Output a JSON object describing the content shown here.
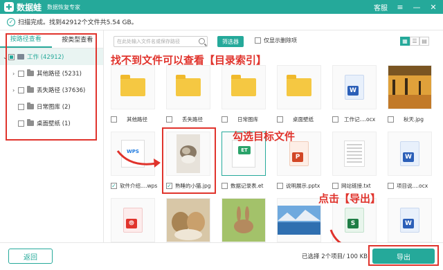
{
  "app": {
    "name": "数据蛙",
    "subtitle": "数据恢复专家",
    "logo_mark": "✚"
  },
  "titlebar": {
    "service": "客服",
    "menu_icon": "≡",
    "minimize": "—",
    "close": "✕"
  },
  "status": {
    "text": "扫描完成。找到42912个文件共5.54 GB。"
  },
  "sidebar": {
    "tabs": [
      {
        "label": "按路径查看",
        "active": true
      },
      {
        "label": "按类型查看",
        "active": false
      }
    ],
    "root": {
      "label": "工作 (42912)"
    },
    "items": [
      {
        "label": "其他路径 (5231)",
        "expandable": true
      },
      {
        "label": "丢失路径 (37636)",
        "expandable": true
      },
      {
        "label": "日常图库 (2)",
        "expandable": false
      },
      {
        "label": "桌面壁纸 (1)",
        "expandable": false
      }
    ]
  },
  "toolbar": {
    "search_placeholder": "在此处输入文件名或保存路径",
    "filter_label": "筛选器",
    "only_deleted_label": "仅显示删除项"
  },
  "tiles": [
    {
      "label": "其他路径",
      "kind": "folder",
      "checked": false
    },
    {
      "label": "丢失路径",
      "kind": "folder",
      "checked": false
    },
    {
      "label": "日常图库",
      "kind": "folder",
      "checked": false
    },
    {
      "label": "桌面壁纸",
      "kind": "folder",
      "checked": false
    },
    {
      "label": "工作记....ocx",
      "kind": "word",
      "checked": false
    },
    {
      "label": "秋天.jpg",
      "kind": "autumn",
      "checked": false
    },
    {
      "label": "软件介绍....wps",
      "kind": "wps",
      "checked": true
    },
    {
      "label": "熟睡的小猫.jpg",
      "kind": "cat",
      "checked": true
    },
    {
      "label": "数据记录表.et",
      "kind": "et",
      "checked": false
    },
    {
      "label": "说明展示.pptx",
      "kind": "ppt",
      "checked": false
    },
    {
      "label": "网站链接.txt",
      "kind": "txt",
      "checked": false
    },
    {
      "label": "项目说....ocx",
      "kind": "word",
      "checked": false
    },
    {
      "label": "",
      "kind": "pdf",
      "checked": false
    },
    {
      "label": "",
      "kind": "kittens",
      "checked": false
    },
    {
      "label": "",
      "kind": "rabbit",
      "checked": false
    },
    {
      "label": "",
      "kind": "lake",
      "checked": false
    },
    {
      "label": "",
      "kind": "excel",
      "checked": false
    },
    {
      "label": "",
      "kind": "word",
      "checked": false
    }
  ],
  "annotations": {
    "hint_index": "找不到文件可以查看【目录索引】",
    "hint_select": "勾选目标文件",
    "hint_export": "点击【导出】"
  },
  "footer": {
    "back_label": "返回",
    "selection_info": "已选择 2个项目/ 100 KB",
    "export_label": "导出"
  },
  "colors": {
    "accent": "#25a99a",
    "annotation": "#e0332c"
  }
}
